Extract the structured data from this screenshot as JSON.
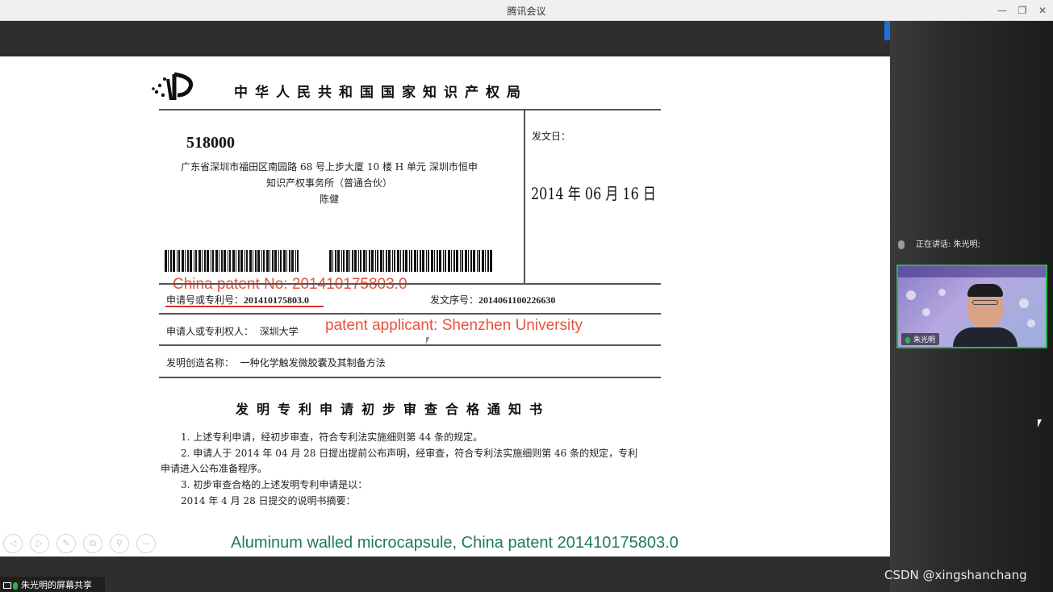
{
  "window": {
    "title": "腾讯会议",
    "minimize": "—",
    "restore": "❐",
    "close": "✕"
  },
  "document": {
    "office_title": "中华人民共和国国家知识产权局",
    "postcode": "518000",
    "address_lines": [
      "广东省深圳市福田区南园路 68 号上步大厦 10 楼 H 单元  深圳市恒申",
      "知识产权事务所（普通合伙）",
      "陈健"
    ],
    "issue_date_label": "发文日：",
    "issue_date": "2014 年 06 月 16 日",
    "annotation_patent_no": "China patent No: 201410175803.0",
    "application_no_label": "申请号或专利号：",
    "application_no": "201410175803.0",
    "serial_no_label": "发文序号：",
    "serial_no": "2014061100226630",
    "applicant_label": "申请人或专利权人：",
    "applicant": "深圳大学",
    "annotation_applicant": "patent applicant: Shenzhen University",
    "invention_label": "发明创造名称：",
    "invention_name": "一种化学触发微胶囊及其制备方法",
    "notice_title": "发明专利申请初步审查合格通知书",
    "paragraphs": [
      "1. 上述专利申请，经初步审查，符合专利法实施细则第 44 条的规定。",
      "2. 申请人于 2014 年 04 月 28 日提出提前公布声明，经审查，符合专利法实施细则第 46 条的规定，专利",
      "申请进入公布准备程序。",
      "3. 初步审查合格的上述发明专利申请是以：",
      "2014 年 4 月 28 日提交的说明书摘要："
    ],
    "caption": "Aluminum walled microcapsule, China patent 201410175803.0"
  },
  "controls": [
    "◁",
    "▷",
    "✎",
    "⧉",
    "⚲",
    "—"
  ],
  "meeting": {
    "speaking_label": "正在讲话: 朱光明;",
    "participant_name": "朱光明",
    "screen_share_label": "朱光明的屏幕共享"
  },
  "watermark": "CSDN @xingshanchang"
}
